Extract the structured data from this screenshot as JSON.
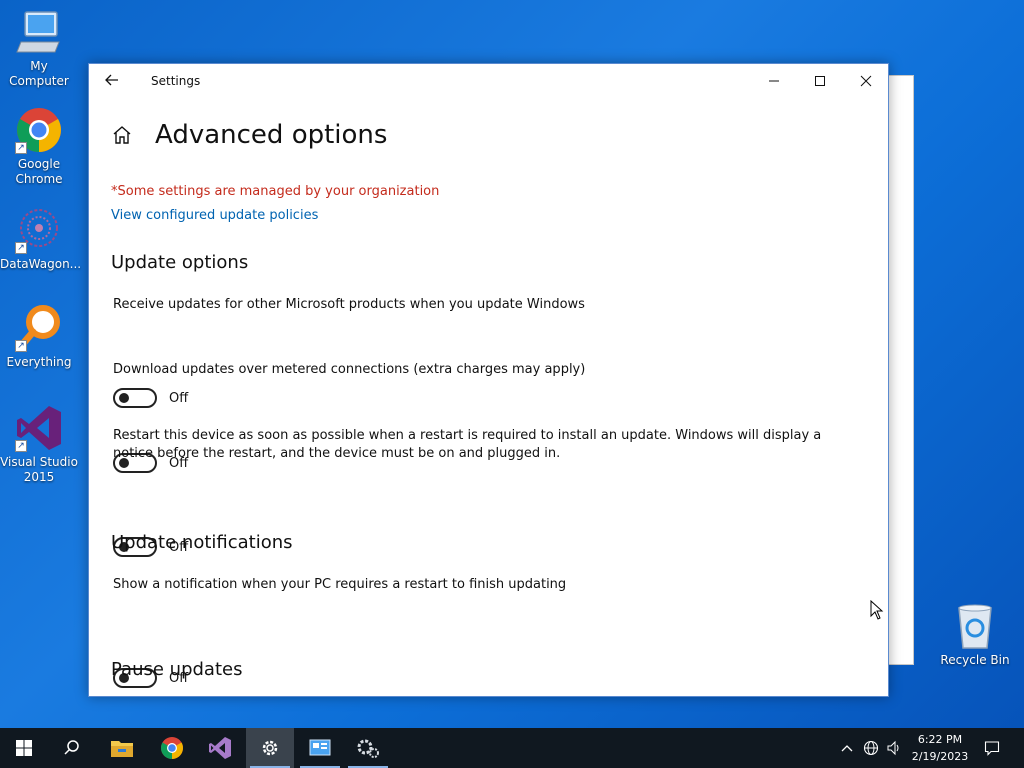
{
  "desktop": {
    "icons": [
      {
        "label": "My Computer"
      },
      {
        "label": "Google Chrome"
      },
      {
        "label": "DataWagon..."
      },
      {
        "label": "Everything"
      },
      {
        "label": "Visual Studio 2015"
      },
      {
        "label": "Recycle Bin"
      }
    ]
  },
  "window": {
    "title": "Settings",
    "controls": {
      "minimize": "—",
      "maximize": "☐",
      "close": "✕"
    }
  },
  "page": {
    "title": "Advanced options",
    "managed_notice": "*Some settings are managed by your organization",
    "policy_link": "View configured update policies"
  },
  "sections": {
    "update_options": {
      "title": "Update options",
      "items": [
        {
          "text": "Receive updates for other Microsoft products when you update Windows",
          "state": "Off",
          "on": false
        },
        {
          "text": "Download updates over metered connections (extra charges may apply)",
          "state": "Off",
          "on": false
        },
        {
          "text": "Restart this device as soon as possible when a restart is required to install an update. Windows will display a notice before the restart, and the device must be on and plugged in.",
          "state": "Off",
          "on": false
        }
      ]
    },
    "update_notifications": {
      "title": "Update notifications",
      "items": [
        {
          "text": "Show a notification when your PC requires a restart to finish updating",
          "state": "Off",
          "on": false
        }
      ]
    },
    "pause_updates": {
      "title": "Pause updates"
    }
  },
  "taskbar": {
    "apps": [
      "start-icon",
      "search-icon",
      "file-explorer-icon",
      "chrome-icon",
      "visual-studio-icon",
      "settings-icon",
      "control-panel-icon",
      "system-settings-icon"
    ],
    "clock": {
      "time": "6:22 PM",
      "date": "2/19/2023"
    }
  },
  "colors": {
    "accent_link": "#0063b1",
    "managed_notice": "#c42b1c",
    "taskbar": "#101820",
    "desktop": "#1a7be0"
  }
}
